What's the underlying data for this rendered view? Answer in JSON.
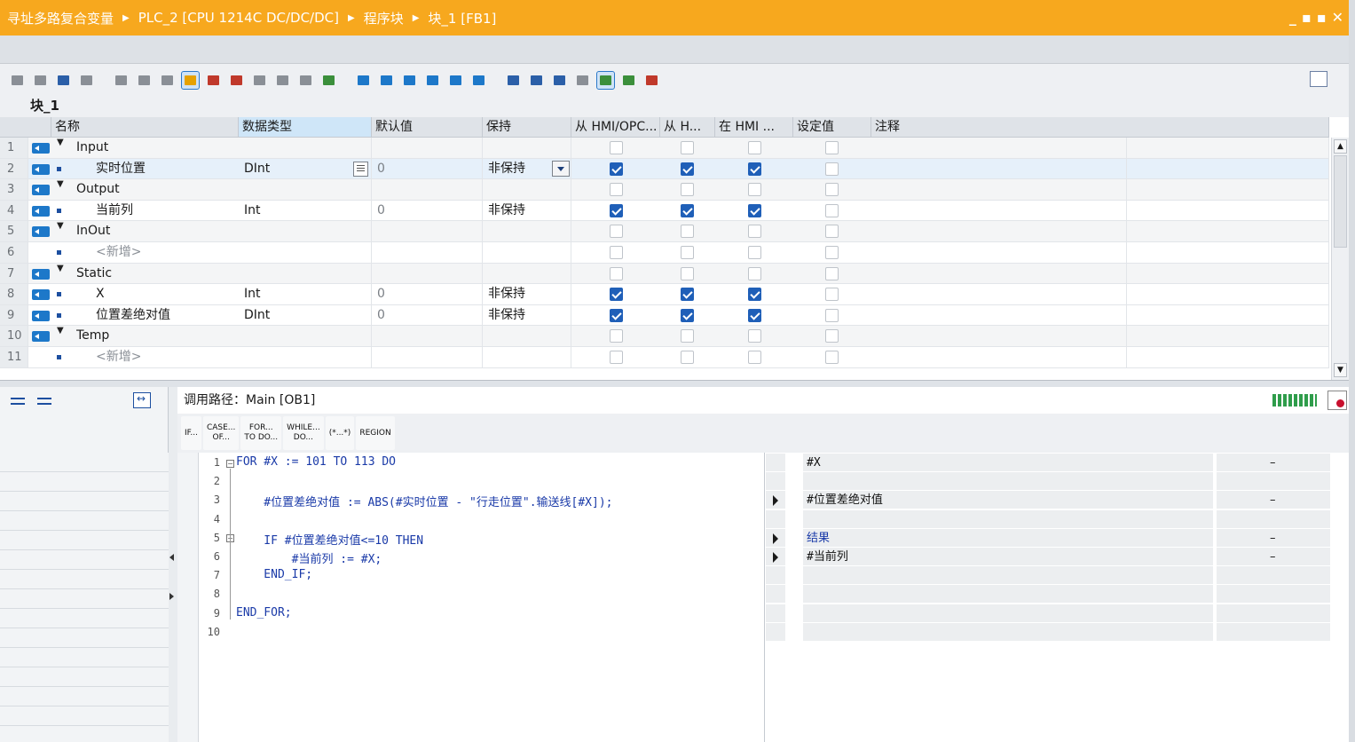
{
  "titlebar": {
    "crumbs": [
      "寻址多路复合变量",
      "PLC_2 [CPU 1214C DC/DC/DC]",
      "程序块",
      "块_1 [FB1]"
    ],
    "window_buttons": [
      "_",
      "▪",
      "▪",
      "✕"
    ]
  },
  "block_name": "块_1",
  "interface": {
    "columns": [
      "名称",
      "数据类型",
      "默认值",
      "保持",
      "从 HMI/OPC...",
      "从 H...",
      "在 HMI ...",
      "设定值",
      "注释"
    ],
    "rows": [
      {
        "num": "1",
        "kind": "section",
        "name": "Input",
        "type": "",
        "default": "",
        "retain": "",
        "hmi1": false,
        "hmi2": false,
        "hmi3": false,
        "setpoint": false
      },
      {
        "num": "2",
        "kind": "var",
        "name": "实时位置",
        "type": "DInt",
        "default": "0",
        "retain": "非保持",
        "hmi1": true,
        "hmi2": true,
        "hmi3": true,
        "setpoint": false
      },
      {
        "num": "3",
        "kind": "section",
        "name": "Output",
        "type": "",
        "default": "",
        "retain": "",
        "hmi1": false,
        "hmi2": false,
        "hmi3": false,
        "setpoint": false
      },
      {
        "num": "4",
        "kind": "var",
        "name": "当前列",
        "type": "Int",
        "default": "0",
        "retain": "非保持",
        "hmi1": true,
        "hmi2": true,
        "hmi3": true,
        "setpoint": false
      },
      {
        "num": "5",
        "kind": "section",
        "name": "InOut",
        "type": "",
        "default": "",
        "retain": "",
        "hmi1": false,
        "hmi2": false,
        "hmi3": false,
        "setpoint": false
      },
      {
        "num": "6",
        "kind": "add",
        "name": "<新增>",
        "type": "",
        "default": "",
        "retain": "",
        "hmi1": false,
        "hmi2": false,
        "hmi3": false,
        "setpoint": false
      },
      {
        "num": "7",
        "kind": "section",
        "name": "Static",
        "type": "",
        "default": "",
        "retain": "",
        "hmi1": false,
        "hmi2": false,
        "hmi3": false,
        "setpoint": false
      },
      {
        "num": "8",
        "kind": "var",
        "name": "X",
        "type": "Int",
        "default": "0",
        "retain": "非保持",
        "hmi1": true,
        "hmi2": true,
        "hmi3": true,
        "setpoint": false
      },
      {
        "num": "9",
        "kind": "var",
        "name": "位置差绝对值",
        "type": "DInt",
        "default": "0",
        "retain": "非保持",
        "hmi1": true,
        "hmi2": true,
        "hmi3": true,
        "setpoint": false
      },
      {
        "num": "10",
        "kind": "section",
        "name": "Temp",
        "type": "",
        "default": "",
        "retain": "",
        "hmi1": false,
        "hmi2": false,
        "hmi3": false,
        "setpoint": false
      },
      {
        "num": "11",
        "kind": "add",
        "name": "<新增>",
        "type": "",
        "default": "",
        "retain": "",
        "hmi1": false,
        "hmi2": false,
        "hmi3": false,
        "setpoint": false
      }
    ]
  },
  "editor": {
    "call_path": "调用路径：Main [OB1]",
    "snippets": [
      {
        "line1": "IF...",
        "line2": ""
      },
      {
        "line1": "CASE...",
        "line2": "OF..."
      },
      {
        "line1": "FOR...",
        "line2": "TO DO..."
      },
      {
        "line1": "WHILE...",
        "line2": "DO..."
      },
      {
        "line1": "(*...*)",
        "line2": ""
      },
      {
        "line1": "REGION",
        "line2": ""
      }
    ],
    "code_lines": [
      "FOR #X := 101 TO 113 DO",
      "",
      "    #位置差绝对值 := ABS(#实时位置 - \"行走位置\".输送线[#X]);",
      "",
      "    IF #位置差绝对值<=10 THEN",
      "        #当前列 := #X;",
      "    END_IF;",
      "",
      "END_FOR;",
      ""
    ],
    "line_numbers": [
      "1",
      "2",
      "3",
      "4",
      "5",
      "6",
      "7",
      "8",
      "9",
      "10"
    ],
    "watch": [
      {
        "line": 1,
        "name": "#X",
        "value": "–",
        "arrow": false
      },
      {
        "line": 3,
        "name": "#位置差绝对值",
        "value": "–",
        "arrow": true
      },
      {
        "line": 5,
        "name": "结果",
        "value": "–",
        "arrow": true
      },
      {
        "line": 6,
        "name": "#当前列",
        "value": "–",
        "arrow": true
      }
    ]
  },
  "colors": {
    "titlebar": "#f7a81e",
    "keyword": "#1a3aa8",
    "checkbox_on": "#1f5fb8"
  }
}
